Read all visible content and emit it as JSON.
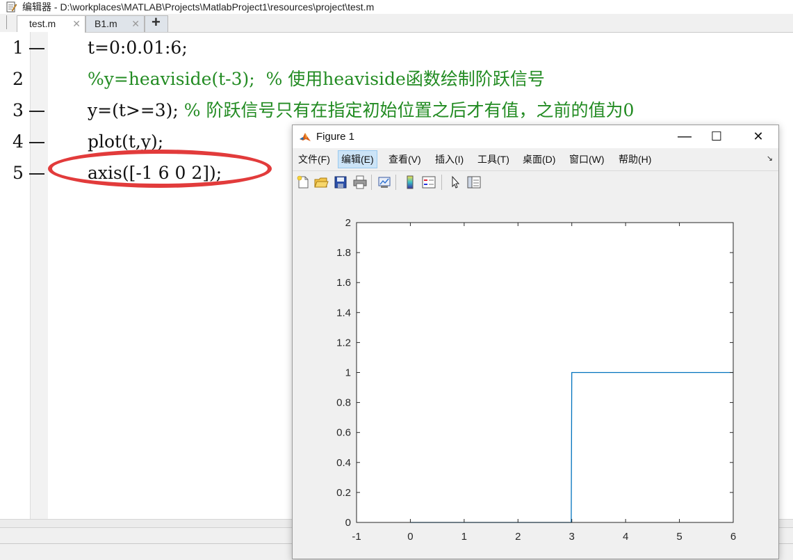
{
  "editor": {
    "title": "编辑器 - D:\\workplaces\\MATLAB\\Projects\\MatlabProject1\\resources\\project\\test.m",
    "tabs": [
      {
        "label": "test.m",
        "close": "✕"
      },
      {
        "label": "B1.m",
        "close": "✕"
      }
    ],
    "add_tab_label": "+",
    "lines": [
      {
        "number": "1",
        "code": "t=0:0.01:6;",
        "comment": "",
        "has_dash": true
      },
      {
        "number": "2",
        "code": "",
        "comment": "%y=heaviside(t-3);  % 使用heaviside函数绘制阶跃信号",
        "has_dash": false
      },
      {
        "number": "3",
        "code": "y=(t>=3); ",
        "comment": "% 阶跃信号只有在指定初始位置之后才有值，之前的值为0",
        "has_dash": true
      },
      {
        "number": "4",
        "code": "plot(t,y);",
        "comment": "",
        "has_dash": true
      },
      {
        "number": "5",
        "code": "axis([-1 6 0 2]);",
        "comment": "",
        "has_dash": true
      }
    ],
    "highlight_color": "#e23b3b",
    "comment_color": "#228b22"
  },
  "figure": {
    "title": "Figure 1",
    "window_buttons": {
      "minimize": "—",
      "maximize": "☐",
      "close": "✕"
    },
    "menus": [
      "文件(F)",
      "编辑(E)",
      "查看(V)",
      "插入(I)",
      "工具(T)",
      "桌面(D)",
      "窗口(W)",
      "帮助(H)"
    ],
    "highlighted_menu_index": 1,
    "menu_overflow": "↘",
    "toolbar_icons": [
      "new-figure-icon",
      "open-file-icon",
      "save-icon",
      "print-icon",
      "link-plot-icon",
      "colorbar-icon",
      "legend-icon",
      "pointer-arrow-icon",
      "property-editor-icon"
    ]
  },
  "chart_data": {
    "type": "line",
    "title": "",
    "xlabel": "",
    "ylabel": "",
    "xlim": [
      -1,
      6
    ],
    "ylim": [
      0,
      2
    ],
    "xticks": [
      "-1",
      "0",
      "1",
      "2",
      "3",
      "4",
      "5",
      "6"
    ],
    "yticks": [
      "0",
      "0.2",
      "0.4",
      "0.6",
      "0.8",
      "1",
      "1.2",
      "1.4",
      "1.6",
      "1.8",
      "2"
    ],
    "series": [
      {
        "x": [
          0,
          2.99,
          3,
          6
        ],
        "y": [
          0,
          0,
          1,
          1
        ],
        "color": "#0072bd"
      }
    ],
    "grid": false,
    "box": true
  }
}
